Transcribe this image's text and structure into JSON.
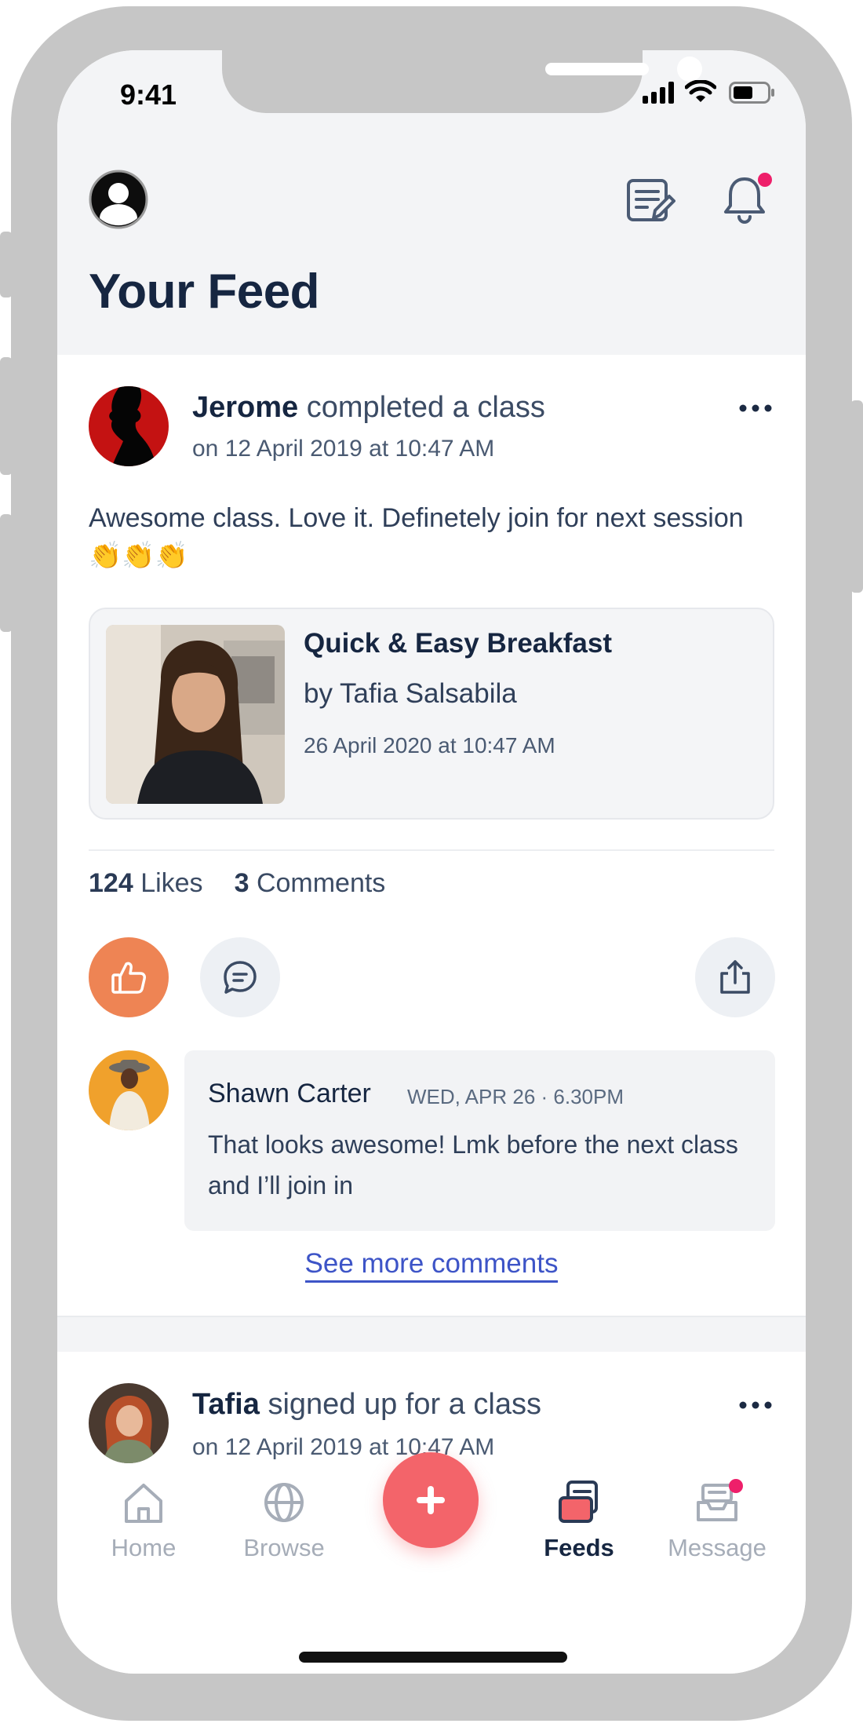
{
  "status_bar": {
    "time": "9:41"
  },
  "header": {
    "title": "Your Feed"
  },
  "posts": [
    {
      "author": "Jerome",
      "action": "completed a class",
      "date": "on 12 April 2019 at 10:47 AM",
      "body": "Awesome class. Love it. Definetely join for next session 👏👏👏",
      "class_card": {
        "title": "Quick & Easy Breakfast",
        "author": "by Tafia Salsabila",
        "date": "26 April 2020 at 10:47 AM"
      },
      "likes_count": "124",
      "likes_label": "Likes",
      "comments_count": "3",
      "comments_label": "Comments",
      "comment": {
        "name": "Shawn Carter",
        "meta": "WED, APR 26 · 6.30PM",
        "text": "That looks awesome! Lmk before the next class and I’ll join in"
      },
      "see_more_label": "See more comments"
    },
    {
      "author": "Tafia",
      "action": "signed up for a class",
      "date": "on 12 April 2019 at 10:47 AM"
    }
  ],
  "tabbar": {
    "home": "Home",
    "browse": "Browse",
    "feeds": "Feeds",
    "message": "Message",
    "active": "Feeds"
  },
  "colors": {
    "like_button": "#ee8454",
    "fab": "#f3646a",
    "notification_dot": "#ee1f6a",
    "link": "#3d54c7",
    "title": "#162641"
  }
}
